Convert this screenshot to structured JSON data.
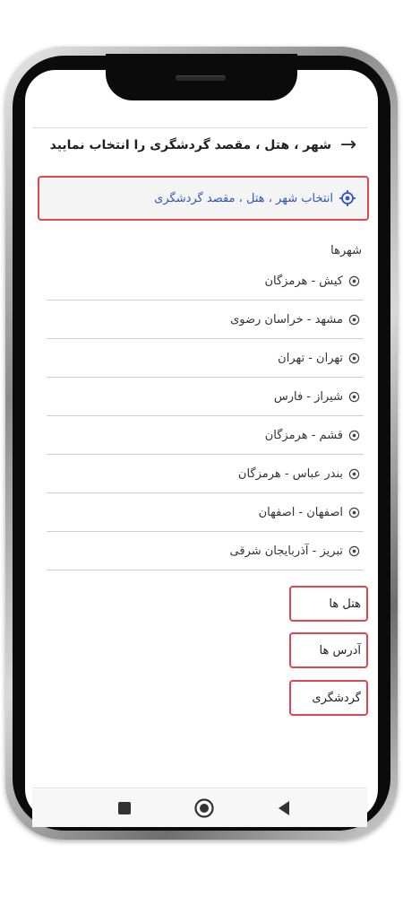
{
  "header": {
    "title": "شهر ، هتل ، مقصد گردشگری را انتخاب نمایید",
    "back_icon": "arrow-right-icon"
  },
  "search": {
    "label": "انتخاب شهر ، هتل ، مقصد گردشگری",
    "icon": "target-icon",
    "accent_color": "#2f56c4",
    "border_color": "#e0464e"
  },
  "cities": {
    "title": "شهرها",
    "items": [
      {
        "label": "کیش - هرمزگان"
      },
      {
        "label": "مشهد - خراسان رضوی"
      },
      {
        "label": "تهران - تهران"
      },
      {
        "label": "شیراز - فارس"
      },
      {
        "label": "قشم - هرمزگان"
      },
      {
        "label": "بندر عباس - هرمزگان"
      },
      {
        "label": "اصفهان - اصفهان"
      },
      {
        "label": "تبریز - آذربایجان شرقی"
      }
    ]
  },
  "categories": {
    "hotels": "هتل ها",
    "addresses": "آدرس ها",
    "tourism": "گردشگری"
  },
  "navbar": {
    "recents_icon": "square-icon",
    "home_icon": "circle-icon",
    "back_icon": "triangle-back-icon"
  }
}
